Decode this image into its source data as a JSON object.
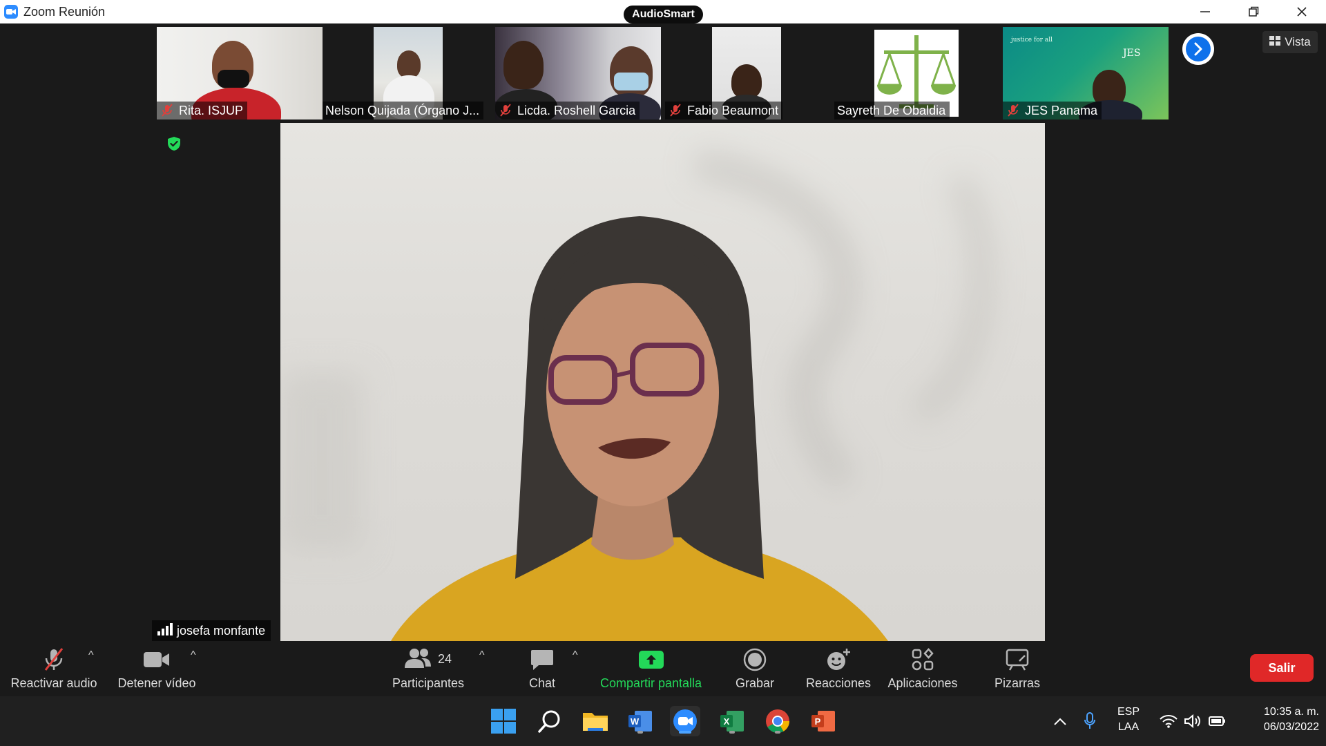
{
  "window": {
    "title": "Zoom Reunión",
    "badge": "AudioSmart",
    "controls": [
      "minimize",
      "restore",
      "close"
    ]
  },
  "view_button": {
    "label": "Vista",
    "icon": "grid-icon"
  },
  "participants_strip": [
    {
      "name": "Rita. ISJUP",
      "muted": true
    },
    {
      "name": "Nelson Quijada (Órgano J...",
      "muted": false
    },
    {
      "name": "Licda. Roshell Garcia",
      "muted": true
    },
    {
      "name": "Fabio Beaumont",
      "muted": true
    },
    {
      "name": "Sayreth De Obaldia",
      "muted": false
    },
    {
      "name": "JES Panama",
      "muted": true,
      "logo_text": "JES",
      "tagline": "justice for all"
    }
  ],
  "active_speaker": {
    "name": "josefa monfante"
  },
  "toolbar": {
    "audio": "Reactivar audio",
    "video": "Detener vídeo",
    "participants": "Participantes",
    "participants_count": "24",
    "chat": "Chat",
    "share": "Compartir pantalla",
    "record": "Grabar",
    "reactions": "Reacciones",
    "apps": "Aplicaciones",
    "whiteboards": "Pizarras",
    "leave": "Salir"
  },
  "colors": {
    "share_green": "#23d959",
    "leave_red": "#e02828",
    "zoom_blue": "#0e71eb",
    "mute_red": "#e0403c"
  },
  "taskbar": {
    "apps": [
      "windows-start",
      "search",
      "file-explorer",
      "word",
      "zoom",
      "excel",
      "chrome",
      "powerpoint"
    ],
    "language_top": "ESP",
    "language_bottom": "LAA",
    "time": "10:35 a. m.",
    "date": "06/03/2022"
  }
}
